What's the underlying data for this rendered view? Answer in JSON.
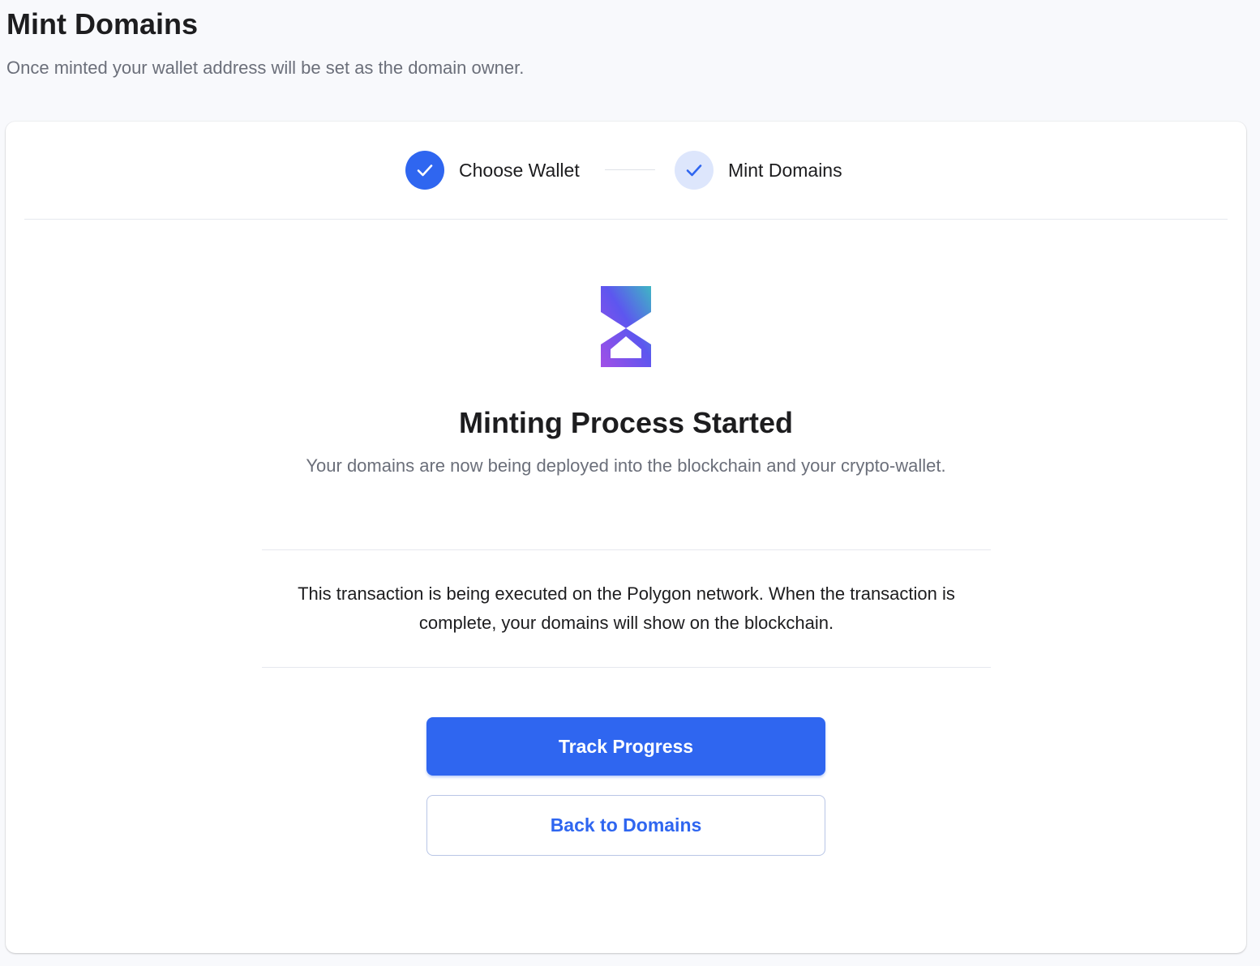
{
  "page": {
    "title": "Mint Domains",
    "subtitle": "Once minted your wallet address will be set as the domain owner."
  },
  "stepper": {
    "steps": [
      {
        "label": "Choose Wallet",
        "status": "completed",
        "icon": "check-icon"
      },
      {
        "label": "Mint Domains",
        "status": "active",
        "icon": "check-icon"
      }
    ]
  },
  "result": {
    "icon": "hourglass-icon",
    "title": "Minting Process Started",
    "description": "Your domains are now being deployed into the blockchain and your crypto-wallet.",
    "info": "This transaction is being executed on the Polygon network. When the transaction is complete, your domains will show on the blockchain."
  },
  "actions": {
    "primary_label": "Track Progress",
    "secondary_label": "Back to Domains"
  },
  "colors": {
    "accent": "#2f66f0",
    "accent_light": "#dde6fc",
    "hourglass_gradient": [
      "#5a55f0",
      "#9b4fe8",
      "#3bb4c8"
    ]
  }
}
